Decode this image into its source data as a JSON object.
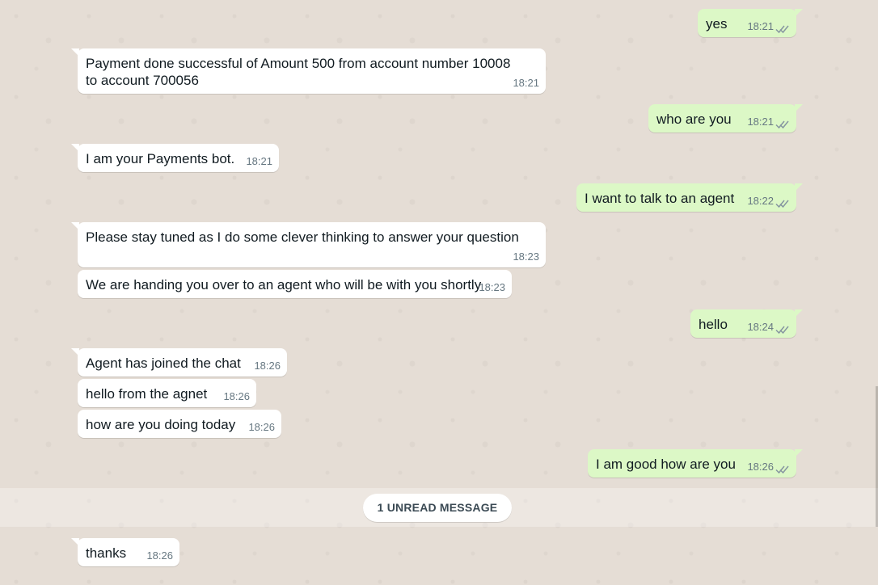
{
  "messages": [
    {
      "id": "m1",
      "direction": "outgoing",
      "text": "yes",
      "time": "18:21"
    },
    {
      "id": "m2",
      "direction": "incoming",
      "text": "Payment done successful of Amount 500 from account number 10008 to account 700056",
      "time": "18:21"
    },
    {
      "id": "m3",
      "direction": "outgoing",
      "text": "who are you",
      "time": "18:21"
    },
    {
      "id": "m4",
      "direction": "incoming",
      "text": "I am your Payments bot.",
      "time": "18:21"
    },
    {
      "id": "m5",
      "direction": "outgoing",
      "text": "I want to talk to an agent",
      "time": "18:22"
    },
    {
      "id": "m6",
      "direction": "incoming",
      "text": "Please stay tuned as I do some clever thinking to answer your question",
      "time": "18:23"
    },
    {
      "id": "m7",
      "direction": "incoming",
      "text": "We are handing you over to an agent who will be with you shortly",
      "time": "18:23"
    },
    {
      "id": "m8",
      "direction": "outgoing",
      "text": "hello",
      "time": "18:24"
    },
    {
      "id": "m9",
      "direction": "incoming",
      "text": "Agent has joined the chat",
      "time": "18:26"
    },
    {
      "id": "m10",
      "direction": "incoming",
      "text": "hello from the agnet",
      "time": "18:26"
    },
    {
      "id": "m11",
      "direction": "incoming",
      "text": "how are you doing today",
      "time": "18:26"
    },
    {
      "id": "m12",
      "direction": "outgoing",
      "text": "I am good how are you",
      "time": "18:26"
    },
    {
      "id": "m13",
      "direction": "incoming",
      "text": "thanks",
      "time": "18:26"
    }
  ],
  "unread_divider": {
    "label": "1 UNREAD MESSAGE"
  },
  "colors": {
    "chat_background": "#e5ddd5",
    "incoming_bubble": "#ffffff",
    "outgoing_bubble": "#dcf8c6",
    "timestamp": "#667781",
    "read_ticks": "#8696a0"
  },
  "icons": {
    "read_status": "double-check-icon"
  }
}
